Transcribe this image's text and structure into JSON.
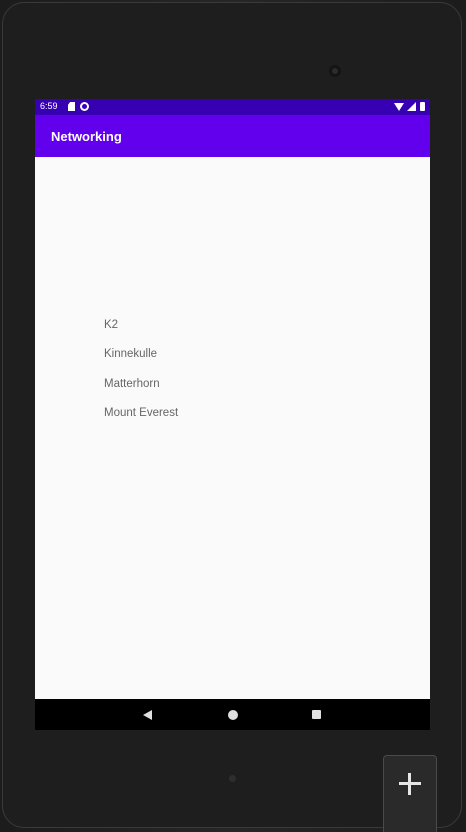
{
  "status_bar": {
    "time": "6:59",
    "icons": [
      "sd-card-icon",
      "sync-icon",
      "wifi-icon",
      "signal-icon",
      "battery-icon"
    ]
  },
  "app_bar": {
    "title": "Networking",
    "color": "#6200ee"
  },
  "colors": {
    "status_bar": "#3700b3",
    "app_bar": "#6200ee",
    "background": "#fafafa",
    "item_text": "#666666"
  },
  "list": {
    "items": [
      {
        "label": "K2"
      },
      {
        "label": "Kinnekulle"
      },
      {
        "label": "Matterhorn"
      },
      {
        "label": "Mount Everest"
      }
    ]
  },
  "nav_bar": {
    "buttons": [
      "back-icon",
      "home-icon",
      "recents-icon"
    ]
  },
  "emulator": {
    "fab_icon": "plus-icon"
  }
}
